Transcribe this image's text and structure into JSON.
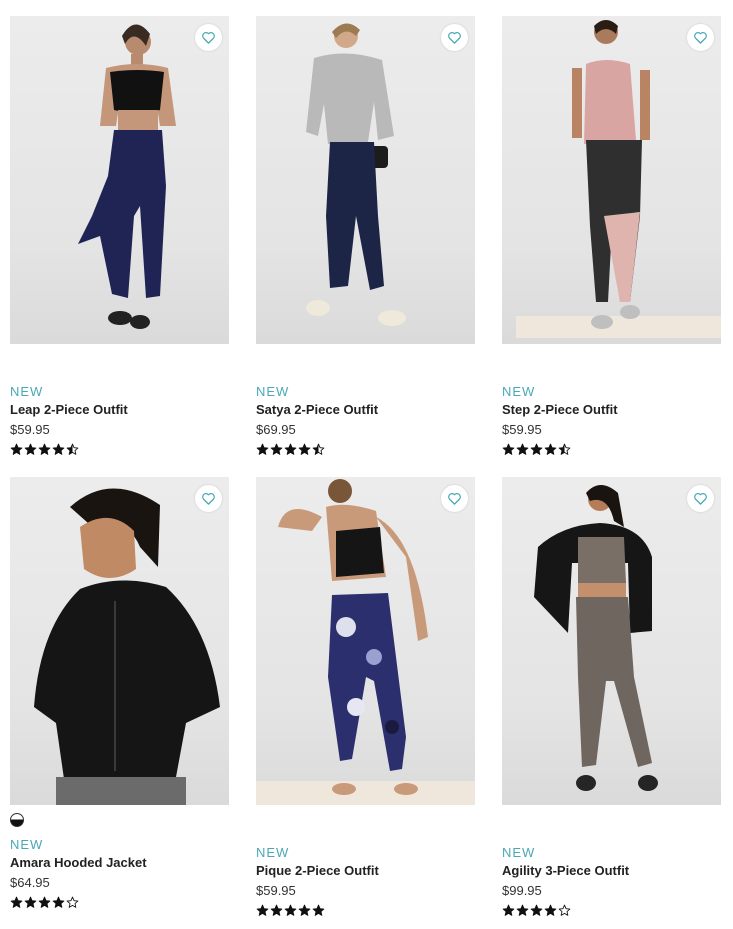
{
  "products": [
    {
      "badge": "NEW",
      "name": "Leap 2-Piece Outfit",
      "price": "$59.95",
      "rating": 4.5,
      "has_swatch": false
    },
    {
      "badge": "NEW",
      "name": "Satya 2-Piece Outfit",
      "price": "$69.95",
      "rating": 4.5,
      "has_swatch": false
    },
    {
      "badge": "NEW",
      "name": "Step 2-Piece Outfit",
      "price": "$59.95",
      "rating": 4.5,
      "has_swatch": false
    },
    {
      "badge": "NEW",
      "name": "Amara Hooded Jacket",
      "price": "$64.95",
      "rating": 4,
      "has_swatch": true
    },
    {
      "badge": "NEW",
      "name": "Pique 2-Piece Outfit",
      "price": "$59.95",
      "rating": 5,
      "has_swatch": false
    },
    {
      "badge": "NEW",
      "name": "Agility 3-Piece Outfit",
      "price": "$99.95",
      "rating": 4,
      "has_swatch": false
    }
  ],
  "colors": {
    "accent": "#4aa8b6",
    "star": "#111111"
  },
  "icons": {
    "favorite": "heart-outline-icon",
    "rating": "star-icon"
  }
}
